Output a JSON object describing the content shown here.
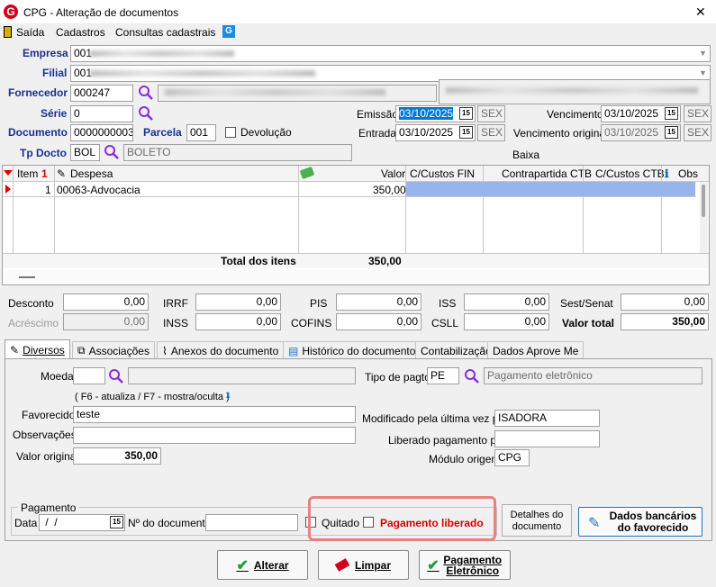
{
  "window": {
    "title": "CPG - Alteração de documentos",
    "close": "✕"
  },
  "menu": {
    "exit": "Saída",
    "registers": "Cadastros",
    "queries": "Consultas cadastrais"
  },
  "header": {
    "empresa_label": "Empresa",
    "empresa_value": "001",
    "filial_label": "Filial",
    "filial_value": "001",
    "fornecedor_label": "Fornecedor",
    "fornecedor_value": "000247",
    "serie_label": "Série",
    "serie_value": "0",
    "documento_label": "Documento",
    "documento_value": "0000000003",
    "parcela_label": "Parcela",
    "parcela_value": "001",
    "devolucao_label": "Devolução",
    "tpdocto_label": "Tp Docto",
    "tpdocto_value": "BOL",
    "tpdocto_desc": "BOLETO",
    "emissao_label": "Emissão",
    "emissao_value": "03/10/2025",
    "emissao_day": "SEX",
    "entrada_label": "Entrada",
    "entrada_value": "03/10/2025",
    "entrada_day": "SEX",
    "vencimento_label": "Vencimento",
    "vencimento_value": "03/10/2025",
    "vencimento_day": "SEX",
    "venc_orig_label": "Vencimento original",
    "venc_orig_value": "03/10/2025",
    "venc_orig_day": "SEX",
    "baixa_label": "Baixa"
  },
  "grid": {
    "col_item": "Item",
    "col_despesa": "Despesa",
    "col_valor": "Valor",
    "col_cc_fin": "C/Custos FIN",
    "col_contra": "Contrapartida CTB",
    "col_cc_ctb": "C/Custos CTB",
    "col_obs": "Obs",
    "row1_item": "1",
    "row1_despesa": "00063-Advocacia",
    "row1_valor": "350,00",
    "total_label": "Total dos itens",
    "total_value": "350,00"
  },
  "taxes": {
    "desconto_label": "Desconto",
    "desconto": "0,00",
    "acrescimo_label": "Acréscimo",
    "acrescimo": "0,00",
    "irrf_label": "IRRF",
    "irrf": "0,00",
    "inss_label": "INSS",
    "inss": "0,00",
    "pis_label": "PIS",
    "pis": "0,00",
    "cofins_label": "COFINS",
    "cofins": "0,00",
    "iss_label": "ISS",
    "iss": "0,00",
    "csll_label": "CSLL",
    "csll": "0,00",
    "sest_label": "Sest/Senat",
    "sest": "0,00",
    "valor_total_label": "Valor total",
    "valor_total": "350,00"
  },
  "tabs": [
    "Diversos",
    "Associações",
    "Anexos do documento",
    "Histórico do documento",
    "Contabilização",
    "Dados Aprove Me"
  ],
  "diversos": {
    "moeda_label": "Moeda",
    "hint": "( F6 - atualiza / F7 - mostra/oculta )",
    "favorecido_label": "Favorecido",
    "favorecido_value": "teste",
    "observacoes_label": "Observações",
    "valor_original_label": "Valor original",
    "valor_original": "350,00",
    "tipo_pagto_label": "Tipo de pagto",
    "tipo_pagto_value": "PE",
    "tipo_pagto_desc": "Pagamento eletrônico",
    "modificado_label": "Modificado pela última vez por",
    "modificado_value": "ISADORA",
    "liberado_label": "Liberado pagamento por",
    "modulo_label": "Módulo origem",
    "modulo_value": "CPG"
  },
  "pagamento": {
    "group_label": "Pagamento",
    "data_label": "Data",
    "data_value": " /  /",
    "ndoc_label": "Nº do documento",
    "quitado_label": "Quitado",
    "liberado_label": "Pagamento liberado",
    "detalhes_label": "Detalhes do documento",
    "dados_bancarios_label": "Dados bancários do favorecido"
  },
  "footer": {
    "alterar": "Alterar",
    "limpar": "Limpar",
    "pagamento_eletronico": "Pagamento Eletrônico"
  },
  "colors": {
    "label_blue": "#1a2f8f",
    "accent_red": "#d60000",
    "highlight": "#e8837c",
    "select_blue": "#0078d7"
  }
}
